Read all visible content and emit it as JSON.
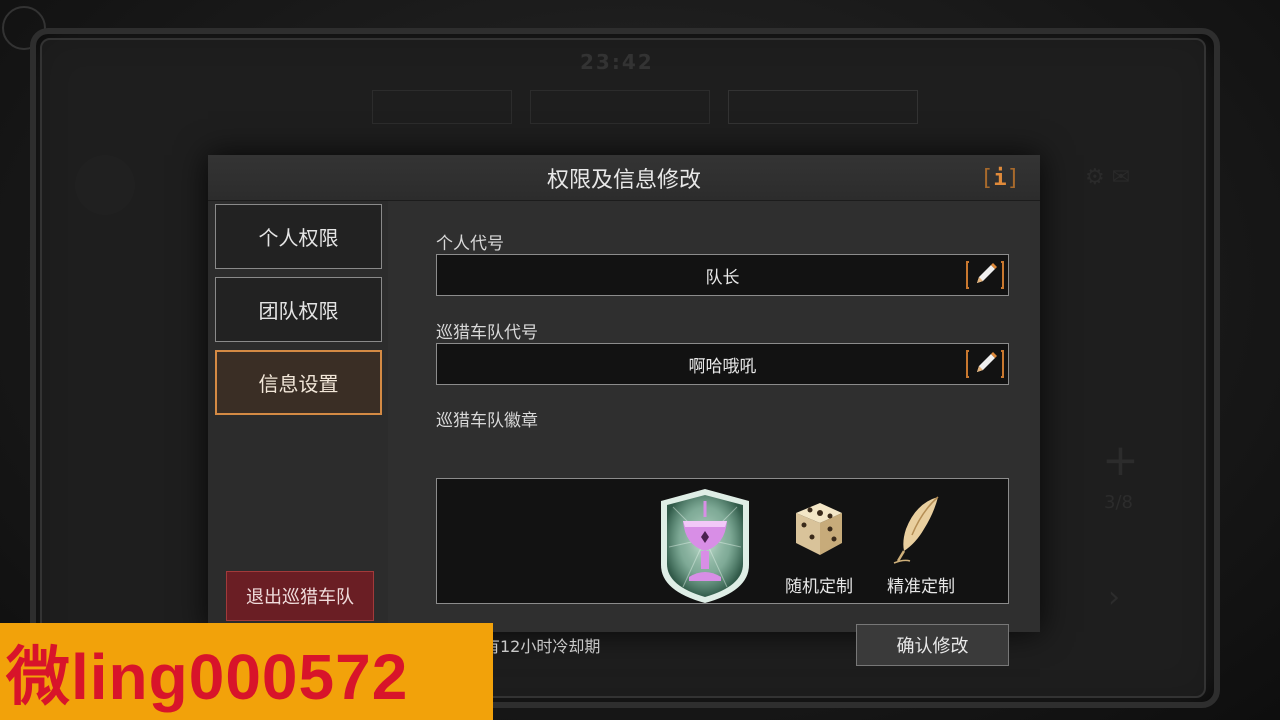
{
  "background": {
    "time": "23:42",
    "tabs": [
      "",
      "",
      ""
    ],
    "count": "3/8"
  },
  "dialog": {
    "title": "权限及信息修改",
    "info_icon": "info-icon",
    "sidebar": {
      "items": [
        {
          "label": "个人权限",
          "active": false
        },
        {
          "label": "团队权限",
          "active": false
        },
        {
          "label": "信息设置",
          "active": true
        }
      ],
      "exit_label": "退出巡猎车队"
    },
    "fields": {
      "personal_code_label": "个人代号",
      "personal_code_value": "队长",
      "team_code_label": "巡猎车队代号",
      "team_code_value": "啊哈哦吼",
      "emblem_label": "巡猎车队徽章"
    },
    "emblem_tools": {
      "random_label": "随机定制",
      "precise_label": "精准定制"
    },
    "cooldown_text": "修改后有12小时冷却期",
    "confirm_label": "确认修改"
  },
  "watermark": "微ling000572",
  "colors": {
    "accent": "#d48a44",
    "exit": "#6a1e24",
    "emblem_cup": "#d88ee6",
    "emblem_shield": "#2f6a52"
  }
}
